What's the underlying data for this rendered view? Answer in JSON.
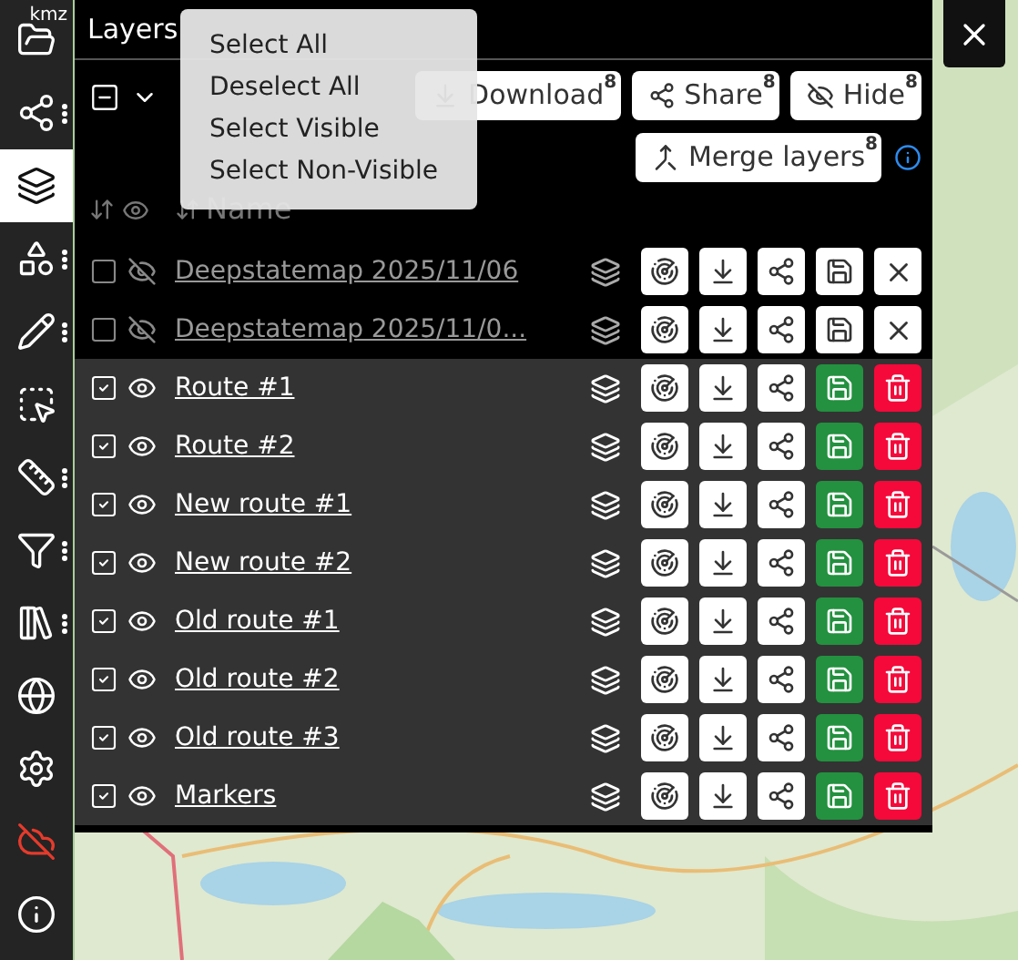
{
  "sidebar": {
    "items": [
      {
        "badge": "kmz",
        "selected": false,
        "menu": false
      },
      {
        "selected": false,
        "menu": true
      },
      {
        "selected": true,
        "menu": false
      },
      {
        "selected": false,
        "menu": true
      },
      {
        "selected": false,
        "menu": true
      },
      {
        "selected": false,
        "menu": false
      },
      {
        "selected": false,
        "menu": true
      },
      {
        "selected": false,
        "menu": true
      },
      {
        "selected": false,
        "menu": true
      },
      {
        "selected": false,
        "menu": false
      },
      {
        "selected": false,
        "menu": false
      },
      {
        "selected": false,
        "menu": false,
        "color": "#e53b2c"
      },
      {
        "selected": false,
        "menu": false
      }
    ]
  },
  "panel": {
    "title": "Layers",
    "select_menu": {
      "items": [
        "Select All",
        "Deselect All",
        "Select Visible",
        "Select Non-Visible"
      ]
    },
    "actions": [
      {
        "label": "Download",
        "count": "8"
      },
      {
        "label": "Share",
        "count": "8"
      },
      {
        "label": "Hide",
        "count": "8"
      },
      {
        "label": "Merge layers",
        "count": "8"
      }
    ],
    "columns": {
      "name": "Name"
    },
    "layers": [
      {
        "name": "Deepstatemap 2025/11/06",
        "checked": false,
        "visible": false,
        "kind": "remote"
      },
      {
        "name": "Deepstatemap 2025/11/0...",
        "checked": false,
        "visible": false,
        "kind": "remote"
      },
      {
        "name": "Route #1",
        "checked": true,
        "visible": true,
        "kind": "local"
      },
      {
        "name": "Route #2",
        "checked": true,
        "visible": true,
        "kind": "local"
      },
      {
        "name": "New route #1",
        "checked": true,
        "visible": true,
        "kind": "local"
      },
      {
        "name": "New route #2",
        "checked": true,
        "visible": true,
        "kind": "local"
      },
      {
        "name": "Old route #1",
        "checked": true,
        "visible": true,
        "kind": "local"
      },
      {
        "name": "Old route #2",
        "checked": true,
        "visible": true,
        "kind": "local"
      },
      {
        "name": "Old route #3",
        "checked": true,
        "visible": true,
        "kind": "local"
      },
      {
        "name": "Markers",
        "checked": true,
        "visible": true,
        "kind": "local"
      }
    ]
  }
}
